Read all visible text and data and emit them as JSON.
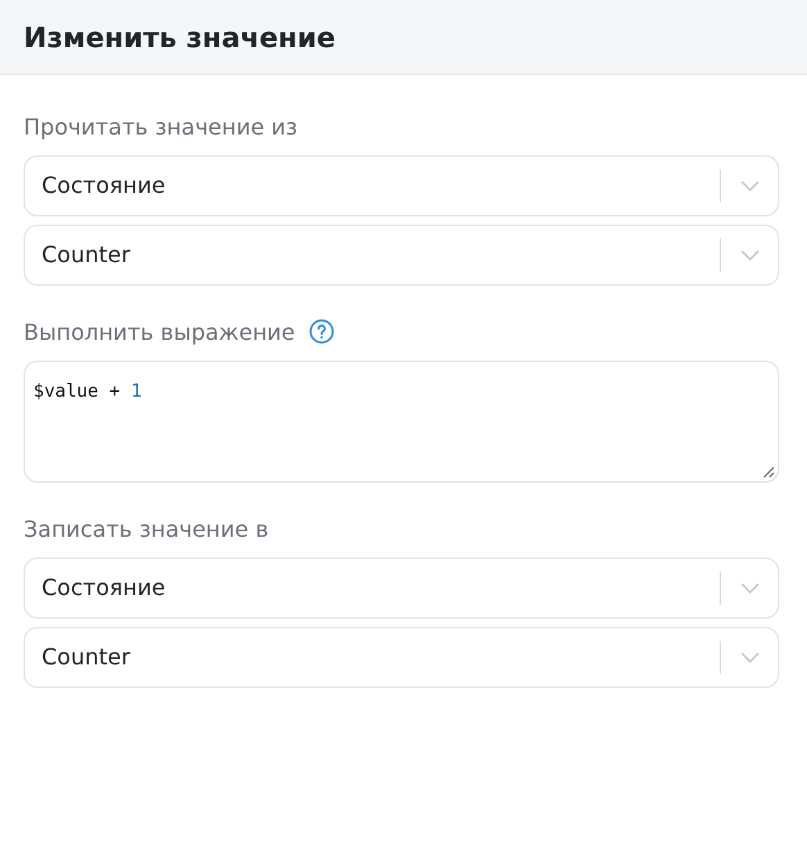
{
  "header": {
    "title": "Изменить значение"
  },
  "sections": [
    {
      "kind": "selects",
      "label": "Прочитать значение из",
      "selects": [
        {
          "value": "Состояние"
        },
        {
          "value": "Counter"
        }
      ]
    },
    {
      "kind": "expression",
      "label": "Выполнить выражение",
      "help": true,
      "tokens": [
        {
          "text": "$value + ",
          "kind": "plain"
        },
        {
          "text": "1",
          "kind": "number"
        }
      ]
    },
    {
      "kind": "selects",
      "label": "Записать значение в",
      "selects": [
        {
          "value": "Состояние"
        },
        {
          "value": "Counter"
        }
      ]
    }
  ]
}
